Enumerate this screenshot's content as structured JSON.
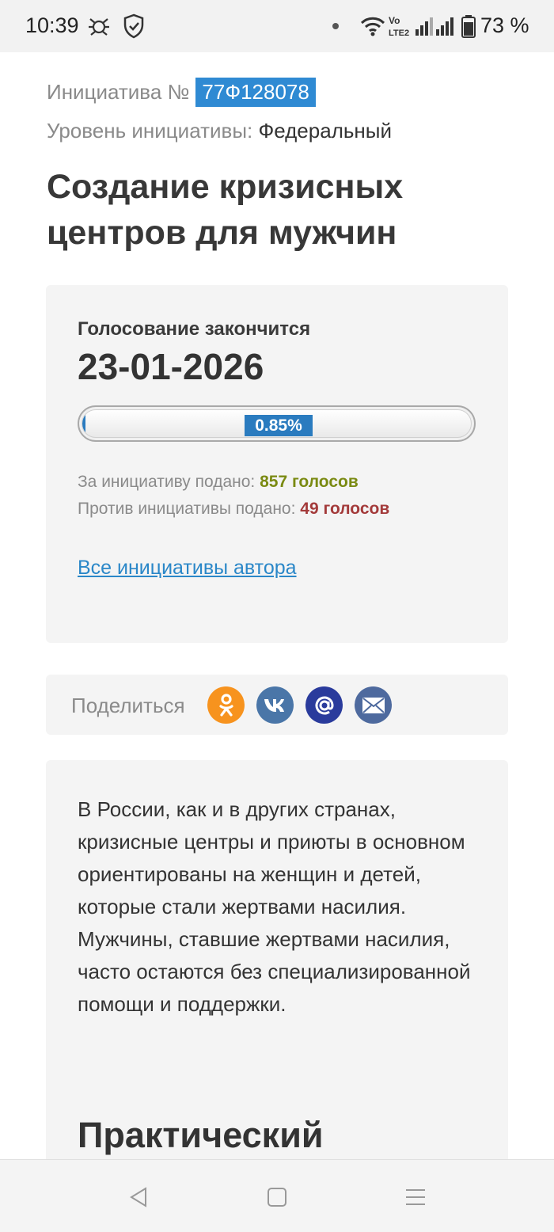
{
  "status_bar": {
    "time": "10:39",
    "battery": "73 %",
    "icons": [
      "drweb-icon",
      "shield-icon",
      "dot-icon",
      "wifi-icon",
      "volte-icon",
      "signal-icon",
      "signal-icon",
      "battery-icon"
    ]
  },
  "initiative": {
    "number_label": "Инициатива №",
    "number": "77Ф128078",
    "level_label": "Уровень инициативы:",
    "level_value": "Федеральный",
    "title": "Создание кризисных центров для мужчин"
  },
  "vote": {
    "ends_label": "Голосование закончится",
    "ends_date": "23-01-2026",
    "progress_percent": 0.85,
    "progress_label": "0.85%",
    "for_label": "За инициативу подано:",
    "for_value": "857 голосов",
    "against_label": "Против инициативы подано:",
    "against_value": "49 голосов",
    "author_link": "Все инициативы автора"
  },
  "share": {
    "label": "Поделиться",
    "buttons": [
      {
        "name": "odnoklassniki-icon",
        "color": "#f7931e"
      },
      {
        "name": "vk-icon",
        "color": "#4a76a8"
      },
      {
        "name": "mailru-icon",
        "color": "#2a3b9c"
      },
      {
        "name": "email-icon",
        "color": "#4e6a9e"
      }
    ]
  },
  "description": {
    "text": "В России, как и в других странах, кризисные центры и приюты в основном ориентированы на женщин и детей, которые стали жертвами насилия. Мужчины, ставшие жертвами насилия, часто остаются без специализированной помощи и поддержки.",
    "heading": "Практический"
  },
  "nav_bar": {
    "buttons": [
      "back-icon",
      "home-icon",
      "menu-icon"
    ]
  },
  "colors": {
    "accent": "#2a7bbf",
    "link": "#2a87c8",
    "for": "#7a8a12",
    "against": "#a33a3a"
  }
}
